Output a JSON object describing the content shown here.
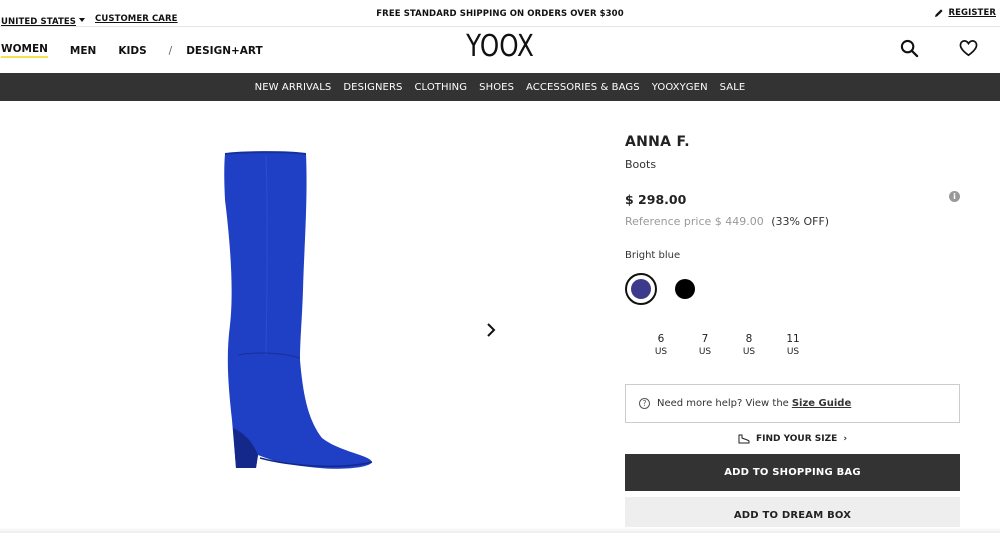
{
  "utility": {
    "country": "UNITED STATES",
    "customer_care": "CUSTOMER CARE",
    "promo": "FREE STANDARD SHIPPING ON ORDERS OVER $300",
    "register": "REGISTER"
  },
  "header": {
    "logo": "YOOX",
    "gender_nav": [
      "WOMEN",
      "MEN",
      "KIDS"
    ],
    "slash": "/",
    "design_art": "DESIGN+ART"
  },
  "catnav": [
    "NEW ARRIVALS",
    "DESIGNERS",
    "CLOTHING",
    "SHOES",
    "ACCESSORIES & BAGS",
    "YOOXYGEN",
    "SALE"
  ],
  "product": {
    "brand": "ANNA F.",
    "type": "Boots",
    "price": "$ 298.00",
    "ref_label": "Reference price",
    "ref_price": "$ 449.00",
    "discount": "(33% OFF)",
    "color_name": "Bright blue",
    "swatch_colors": [
      "#3d3a8c",
      "#000000"
    ],
    "sizes": [
      {
        "num": "6",
        "unit": "US"
      },
      {
        "num": "7",
        "unit": "US"
      },
      {
        "num": "8",
        "unit": "US"
      },
      {
        "num": "11",
        "unit": "US"
      }
    ],
    "help_text": "Need more help? View the",
    "size_guide": "Size Guide",
    "find_size": "FIND YOUR SIZE",
    "add_to_bag": "ADD TO SHOPPING BAG",
    "add_to_dream": "ADD TO DREAM BOX",
    "image_color": "#1f3fc4"
  }
}
